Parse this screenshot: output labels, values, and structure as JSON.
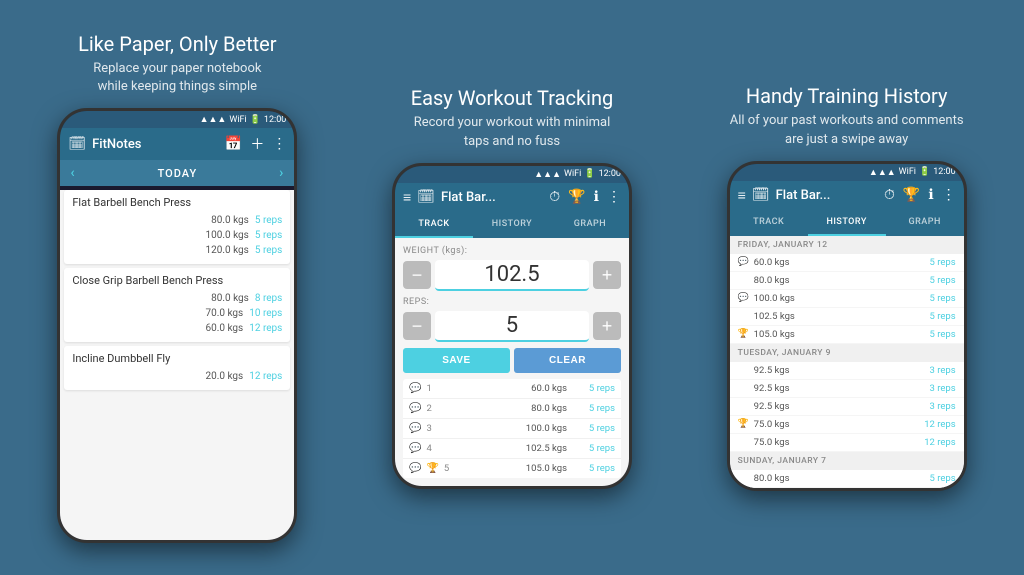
{
  "panels": [
    {
      "id": "panel1",
      "heading": "Like Paper, Only Better",
      "subtext": "Replace your paper notebook\nwhile keeping things simple",
      "phone": {
        "statusBar": {
          "time": "12:00"
        },
        "toolbar": {
          "icon": "🗓",
          "title": "FitNotes",
          "actions": [
            "📅",
            "+",
            "⋮"
          ]
        },
        "todayBar": {
          "label": "TODAY"
        },
        "exercises": [
          {
            "name": "Flat Barbell Bench Press",
            "sets": [
              {
                "weight": "80.0 kgs",
                "reps": "5 reps"
              },
              {
                "weight": "100.0 kgs",
                "reps": "5 reps"
              },
              {
                "weight": "120.0 kgs",
                "reps": "5 reps"
              }
            ]
          },
          {
            "name": "Close Grip Barbell Bench Press",
            "sets": [
              {
                "weight": "80.0 kgs",
                "reps": "8 reps"
              },
              {
                "weight": "70.0 kgs",
                "reps": "10 reps"
              },
              {
                "weight": "60.0 kgs",
                "reps": "12 reps"
              }
            ]
          },
          {
            "name": "Incline Dumbbell Fly",
            "sets": [
              {
                "weight": "20.0 kgs",
                "reps": "12 reps"
              }
            ]
          }
        ]
      }
    },
    {
      "id": "panel2",
      "heading": "Easy Workout Tracking",
      "subtext": "Record your workout with minimal\ntaps and no fuss",
      "phone": {
        "statusBar": {
          "time": "12:00"
        },
        "toolbar": {
          "icon": "≡",
          "title": "Flat Bar...",
          "actions": [
            "⏱",
            "🏆",
            "ℹ",
            "⋮"
          ]
        },
        "tabs": [
          "TRACK",
          "HISTORY",
          "GRAPH"
        ],
        "activeTab": 0,
        "weightLabel": "WEIGHT (kgs):",
        "weightValue": "102.5",
        "repsLabel": "REPS:",
        "repsValue": "5",
        "saveLabel": "SAVE",
        "clearLabel": "CLEAR",
        "sets": [
          {
            "num": "1",
            "weight": "60.0 kgs",
            "reps": "5 reps",
            "icon": "chat",
            "trophy": false
          },
          {
            "num": "2",
            "weight": "80.0 kgs",
            "reps": "5 reps",
            "icon": "chat",
            "trophy": false
          },
          {
            "num": "3",
            "weight": "100.0 kgs",
            "reps": "5 reps",
            "icon": "chat",
            "trophy": false
          },
          {
            "num": "4",
            "weight": "102.5 kgs",
            "reps": "5 reps",
            "icon": "chat",
            "trophy": false
          },
          {
            "num": "5",
            "weight": "105.0 kgs",
            "reps": "5 reps",
            "icon": "chat",
            "trophy": true
          }
        ]
      }
    },
    {
      "id": "panel3",
      "heading": "Handy Training History",
      "subtext": "All of your past workouts and comments\nare just a swipe away",
      "phone": {
        "statusBar": {
          "time": "12:00"
        },
        "toolbar": {
          "icon": "≡",
          "title": "Flat Bar...",
          "actions": [
            "⏱",
            "🏆",
            "ℹ",
            "⋮"
          ]
        },
        "tabs": [
          "TRACK",
          "HISTORY",
          "GRAPH"
        ],
        "activeTab": 1,
        "historyGroups": [
          {
            "date": "FRIDAY, JANUARY 12",
            "rows": [
              {
                "weight": "60.0 kgs",
                "reps": "5 reps",
                "icon": "chat",
                "trophy": false
              },
              {
                "weight": "80.0 kgs",
                "reps": "5 reps",
                "icon": "",
                "trophy": false
              },
              {
                "weight": "100.0 kgs",
                "reps": "5 reps",
                "icon": "chat",
                "trophy": false
              },
              {
                "weight": "102.5 kgs",
                "reps": "5 reps",
                "icon": "",
                "trophy": false
              },
              {
                "weight": "105.0 kgs",
                "reps": "5 reps",
                "icon": "",
                "trophy": true
              }
            ]
          },
          {
            "date": "TUESDAY, JANUARY 9",
            "rows": [
              {
                "weight": "92.5 kgs",
                "reps": "3 reps",
                "icon": "",
                "trophy": false
              },
              {
                "weight": "92.5 kgs",
                "reps": "3 reps",
                "icon": "",
                "trophy": false
              },
              {
                "weight": "92.5 kgs",
                "reps": "3 reps",
                "icon": "",
                "trophy": false
              },
              {
                "weight": "75.0 kgs",
                "reps": "12 reps",
                "icon": "",
                "trophy": true
              },
              {
                "weight": "75.0 kgs",
                "reps": "12 reps",
                "icon": "",
                "trophy": false
              }
            ]
          },
          {
            "date": "SUNDAY, JANUARY 7",
            "rows": [
              {
                "weight": "80.0 kgs",
                "reps": "5 reps",
                "icon": "",
                "trophy": false
              }
            ]
          }
        ]
      }
    }
  ]
}
